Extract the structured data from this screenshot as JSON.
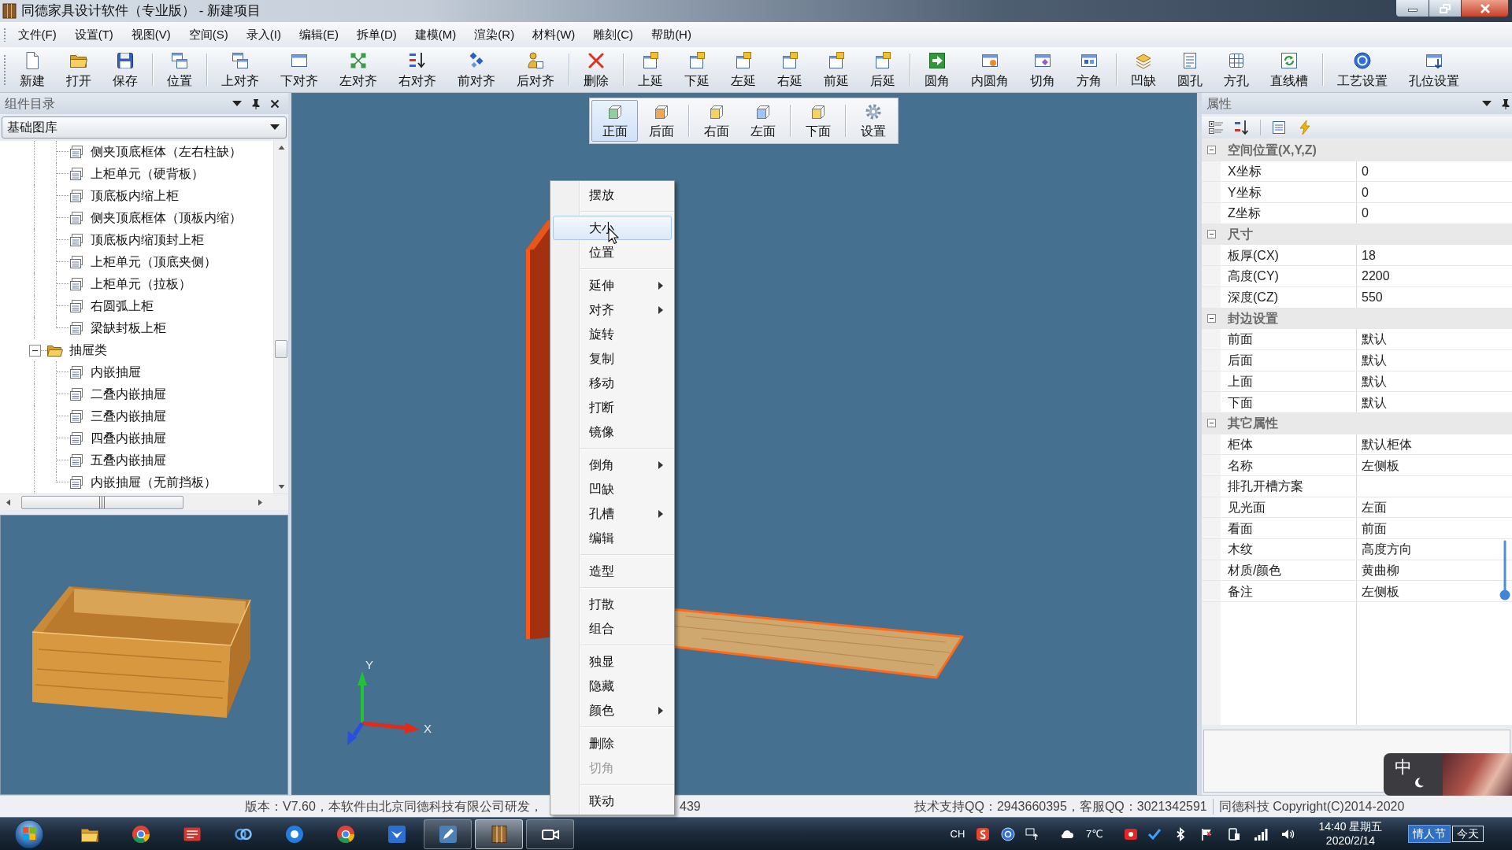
{
  "window": {
    "title": "同德家具设计软件（专业版） - 新建项目"
  },
  "menu_bar": [
    "文件(F)",
    "设置(T)",
    "视图(V)",
    "空间(S)",
    "录入(I)",
    "编辑(E)",
    "拆单(D)",
    "建模(M)",
    "渲染(R)",
    "材料(W)",
    "雕刻(C)",
    "帮助(H)"
  ],
  "toolbar": {
    "groups": [
      [
        "新建",
        "打开",
        "保存"
      ],
      [
        "位置"
      ],
      [
        "上对齐",
        "下对齐",
        "左对齐",
        "右对齐",
        "前对齐",
        "后对齐"
      ],
      [
        "删除"
      ],
      [
        "上延",
        "下延",
        "左延",
        "右延",
        "前延",
        "后延"
      ],
      [
        "圆角",
        "内圆角",
        "切角",
        "方角"
      ],
      [
        "凹缺",
        "圆孔",
        "方孔",
        "直线槽"
      ],
      [
        "工艺设置",
        "孔位设置"
      ]
    ]
  },
  "component_panel": {
    "title": "组件目录",
    "library": "基础图库",
    "tree": [
      {
        "children": [
          {
            "label": "侧夹顶底框体（左右柱缺）"
          },
          {
            "label": "上柜单元（硬背板）"
          },
          {
            "label": "顶底板内缩上柜"
          },
          {
            "label": "侧夹顶底框体（顶板内缩）"
          },
          {
            "label": "顶底板内缩顶封上柜"
          },
          {
            "label": "上柜单元（顶底夹侧）"
          },
          {
            "label": "上柜单元（拉板）"
          },
          {
            "label": "右圆弧上柜"
          },
          {
            "label": "梁缺封板上柜"
          }
        ]
      },
      {
        "label": "抽屉类",
        "expanded": true,
        "children": [
          {
            "label": "内嵌抽屉"
          },
          {
            "label": "二叠内嵌抽屉"
          },
          {
            "label": "三叠内嵌抽屉"
          },
          {
            "label": "四叠内嵌抽屉"
          },
          {
            "label": "五叠内嵌抽屉"
          },
          {
            "label": "内嵌抽屉（无前挡板）"
          }
        ]
      }
    ]
  },
  "viewport": {
    "view_buttons": [
      {
        "label": "正面",
        "selected": true
      },
      {
        "label": "后面",
        "selected": false
      },
      {
        "label": "右面",
        "selected": false
      },
      {
        "label": "左面",
        "selected": false
      },
      {
        "label": "下面",
        "selected": false
      },
      {
        "label": "设置",
        "selected": false
      }
    ],
    "axes": {
      "y_label": "Y",
      "x_label": "X"
    }
  },
  "context_menu": {
    "groups": [
      [
        {
          "label": "摆放",
          "highlighted": false,
          "disabled": false,
          "submenu": false
        }
      ],
      [
        {
          "label": "大小",
          "highlighted": true,
          "disabled": false,
          "submenu": false
        },
        {
          "label": "位置",
          "highlighted": false,
          "disabled": false,
          "submenu": false
        }
      ],
      [
        {
          "label": "延伸",
          "highlighted": false,
          "disabled": false,
          "submenu": true
        },
        {
          "label": "对齐",
          "highlighted": false,
          "disabled": false,
          "submenu": true
        },
        {
          "label": "旋转",
          "highlighted": false,
          "disabled": false,
          "submenu": false
        },
        {
          "label": "复制",
          "highlighted": false,
          "disabled": false,
          "submenu": false
        },
        {
          "label": "移动",
          "highlighted": false,
          "disabled": false,
          "submenu": false
        },
        {
          "label": "打断",
          "highlighted": false,
          "disabled": false,
          "submenu": false
        },
        {
          "label": "镜像",
          "highlighted": false,
          "disabled": false,
          "submenu": false
        }
      ],
      [
        {
          "label": "倒角",
          "highlighted": false,
          "disabled": false,
          "submenu": true
        },
        {
          "label": "凹缺",
          "highlighted": false,
          "disabled": false,
          "submenu": false
        },
        {
          "label": "孔槽",
          "highlighted": false,
          "disabled": false,
          "submenu": true
        },
        {
          "label": "编辑",
          "highlighted": false,
          "disabled": false,
          "submenu": false
        }
      ],
      [
        {
          "label": "造型",
          "highlighted": false,
          "disabled": false,
          "submenu": false
        }
      ],
      [
        {
          "label": "打散",
          "highlighted": false,
          "disabled": false,
          "submenu": false
        },
        {
          "label": "组合",
          "highlighted": false,
          "disabled": false,
          "submenu": false
        }
      ],
      [
        {
          "label": "独显",
          "highlighted": false,
          "disabled": false,
          "submenu": false
        },
        {
          "label": "隐藏",
          "highlighted": false,
          "disabled": false,
          "submenu": false
        },
        {
          "label": "颜色",
          "highlighted": false,
          "disabled": false,
          "submenu": true
        }
      ],
      [
        {
          "label": "删除",
          "highlighted": false,
          "disabled": false,
          "submenu": false
        },
        {
          "label": "切角",
          "highlighted": false,
          "disabled": true,
          "submenu": false
        }
      ],
      [
        {
          "label": "联动",
          "highlighted": false,
          "disabled": false,
          "submenu": false
        }
      ]
    ]
  },
  "properties": {
    "title": "属性",
    "categories": [
      {
        "label": "空间位置(X,Y,Z)",
        "expanded": true,
        "rows": [
          {
            "name": "X坐标",
            "value": "0"
          },
          {
            "name": "Y坐标",
            "value": "0"
          },
          {
            "name": "Z坐标",
            "value": "0"
          }
        ]
      },
      {
        "label": "尺寸",
        "expanded": true,
        "rows": [
          {
            "name": "板厚(CX)",
            "value": "18"
          },
          {
            "name": "高度(CY)",
            "value": "2200"
          },
          {
            "name": "深度(CZ)",
            "value": "550"
          }
        ]
      },
      {
        "label": "封边设置",
        "expanded": true,
        "rows": [
          {
            "name": "前面",
            "value": "默认"
          },
          {
            "name": "后面",
            "value": "默认"
          },
          {
            "name": "上面",
            "value": "默认"
          },
          {
            "name": "下面",
            "value": "默认"
          }
        ]
      },
      {
        "label": "其它属性",
        "expanded": true,
        "rows": [
          {
            "name": "柜体",
            "value": "默认柜体"
          },
          {
            "name": "名称",
            "value": "左侧板"
          },
          {
            "name": "排孔开槽方案"
          },
          {
            "name": "见光面",
            "value": "左面"
          },
          {
            "name": "看面",
            "value": "前面"
          },
          {
            "name": "木纹",
            "value": "高度方向"
          },
          {
            "name": "材质/颜色",
            "value": "黄曲柳"
          },
          {
            "name": "备注",
            "value": "左侧板"
          }
        ]
      }
    ]
  },
  "status_bar": {
    "version": "版本：V7.60，本软件由北京同德科技有限公司研发，",
    "version_tail": "439",
    "support": "技术支持QQ：2943660395，客服QQ：3021342591",
    "copyright": "同德科技 Copyright(C)2014-2020"
  },
  "ime_widget": {
    "mode": "中"
  },
  "taskbar": {
    "apps": [
      {
        "running": false,
        "selected": false
      },
      {
        "running": false,
        "selected": false
      },
      {
        "running": false,
        "selected": false
      },
      {
        "running": false,
        "selected": false
      },
      {
        "running": false,
        "selected": false
      },
      {
        "running": false,
        "selected": false
      },
      {
        "running": false,
        "selected": false
      },
      {
        "running": true,
        "selected": false
      },
      {
        "running": true,
        "selected": true
      },
      {
        "running": true,
        "selected": false
      }
    ],
    "tray": {
      "language": "CH",
      "temperature": "7℃",
      "time": "14:40 星期五",
      "date": "2020/2/14",
      "holiday": "情人节",
      "today": "今天"
    }
  }
}
